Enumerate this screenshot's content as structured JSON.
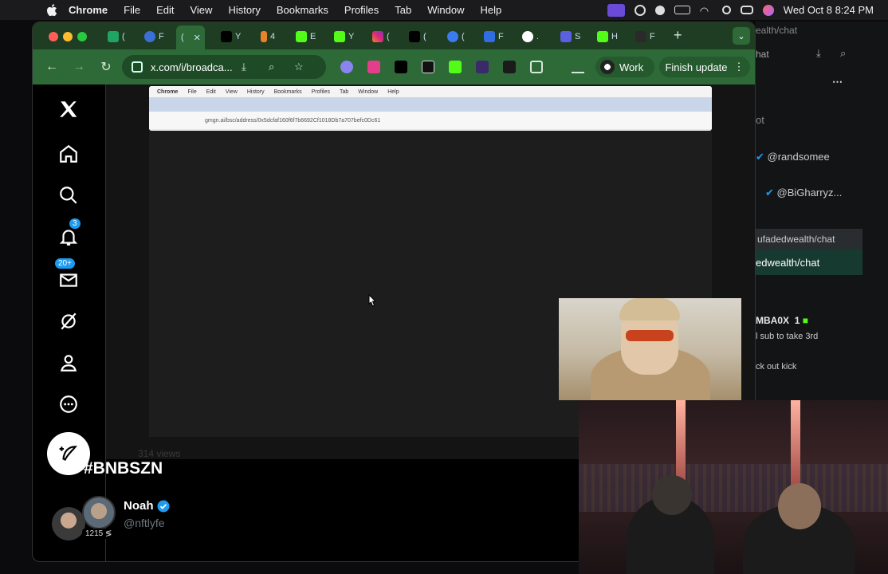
{
  "menubar": {
    "app": "Chrome",
    "items": [
      "File",
      "Edit",
      "View",
      "History",
      "Bookmarks",
      "Profiles",
      "Tab",
      "Window",
      "Help"
    ],
    "datetime": "Wed Oct 8  8:24 PM"
  },
  "browser": {
    "url": "x.com/i/broadca...",
    "profile_label": "Work",
    "finish_update_label": "Finish update"
  },
  "x_nav": {
    "notifications_badge": "3",
    "messages_badge": "20+"
  },
  "broadcast": {
    "views": "314 views",
    "title": "#BNBSZN",
    "host_name": "Noah",
    "host_handle": "@nftlyfe",
    "host_count": "1215 ≶"
  },
  "inner_screen": {
    "menu_app": "Chrome",
    "menu_items": [
      "File",
      "Edit",
      "View",
      "History",
      "Bookmarks",
      "Profiles",
      "Tab",
      "Window",
      "Help"
    ],
    "url": "gmgn.ai/bsc/address/0x5dcfaf160f6f7b6692Cf1018Db7a707befc0Dc61"
  },
  "background_window": {
    "url_fragment": "ealth/chat",
    "tab_fragment": "hat",
    "ot": "ot",
    "user1": "@randsomee",
    "user2": "@BiGharryz...",
    "chat_tab": "ufadedwealth/chat",
    "chat_active": "edwealth/chat",
    "sub_user": "MBA0X",
    "sub_count": "1",
    "sub_text": "l sub to take 3rd",
    "kick_text": "ck out kick"
  }
}
